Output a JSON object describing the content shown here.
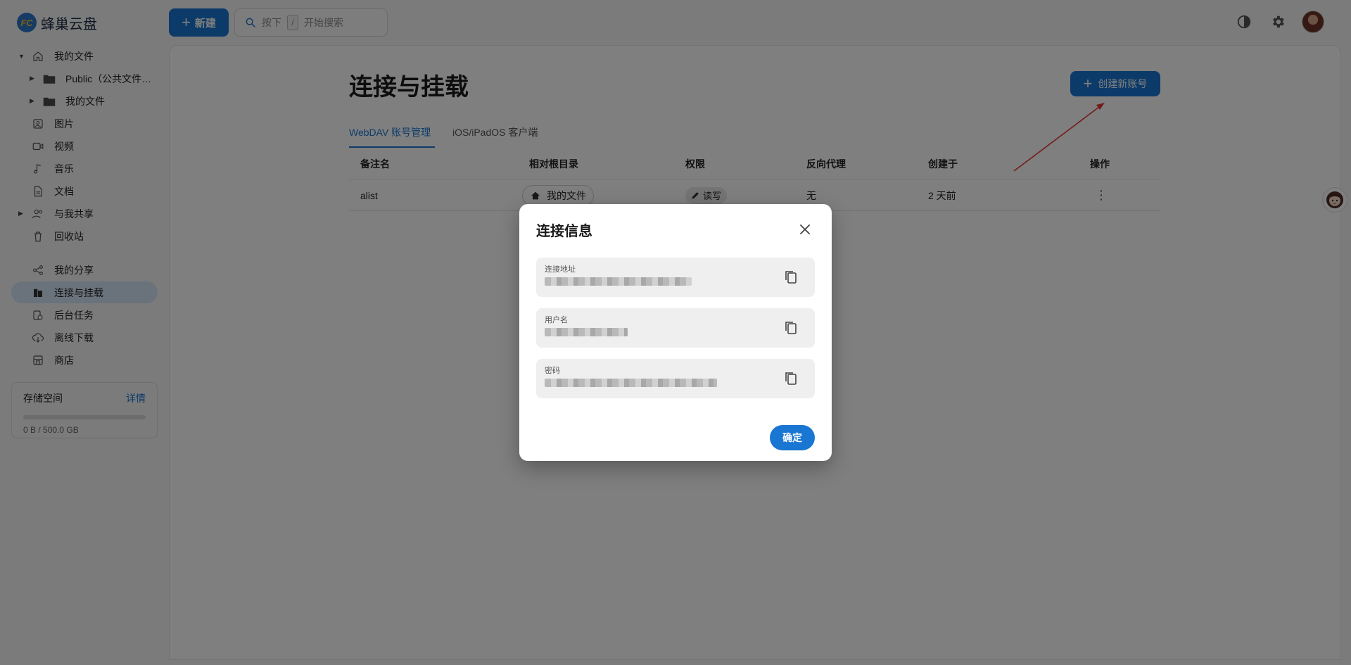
{
  "app": {
    "name": "蜂巢云盘",
    "logo_text": "FC"
  },
  "topbar": {
    "new_label": "新建",
    "search_prefix": "按下",
    "search_key": "/",
    "search_placeholder": "开始搜索"
  },
  "sidebar": {
    "items": [
      {
        "label": "我的文件",
        "icon": "home-icon"
      },
      {
        "label": "Public（公共文件…",
        "icon": "folder-icon"
      },
      {
        "label": "我的文件",
        "icon": "folder-icon"
      },
      {
        "label": "图片",
        "icon": "image-icon"
      },
      {
        "label": "视频",
        "icon": "video-icon"
      },
      {
        "label": "音乐",
        "icon": "music-icon"
      },
      {
        "label": "文档",
        "icon": "document-icon"
      },
      {
        "label": "与我共享",
        "icon": "people-icon"
      },
      {
        "label": "回收站",
        "icon": "trash-icon"
      },
      {
        "label": "我的分享",
        "icon": "share-icon"
      },
      {
        "label": "连接与挂载",
        "icon": "storage-icon"
      },
      {
        "label": "后台任务",
        "icon": "task-icon"
      },
      {
        "label": "离线下载",
        "icon": "cloud-download-icon"
      },
      {
        "label": "商店",
        "icon": "store-icon"
      }
    ],
    "storage": {
      "title": "存储空间",
      "detail": "详情",
      "used": "0 B / 500.0 GB",
      "fraction": 0
    }
  },
  "main": {
    "title": "连接与挂载",
    "create_label": "创建新账号",
    "tabs": [
      {
        "label": "WebDAV 账号管理",
        "active": true
      },
      {
        "label": "iOS/iPadOS 客户端",
        "active": false
      }
    ],
    "table": {
      "headers": [
        "备注名",
        "相对根目录",
        "权限",
        "反向代理",
        "创建于",
        "操作"
      ],
      "rows": [
        {
          "name": "alist",
          "root": "我的文件",
          "permission": "读写",
          "proxy": "无",
          "created": "2 天前"
        }
      ]
    }
  },
  "dialog": {
    "title": "连接信息",
    "fields": [
      {
        "label": "连接地址",
        "value": "",
        "blurred": true
      },
      {
        "label": "用户名",
        "value": "",
        "blurred": true
      },
      {
        "label": "密码",
        "value": "",
        "blurred": true
      }
    ],
    "ok_label": "确定"
  },
  "colors": {
    "accent": "#1976d2",
    "annotation_arrow": "#e53935",
    "overlay": "rgba(0,0,0,0.5)"
  }
}
